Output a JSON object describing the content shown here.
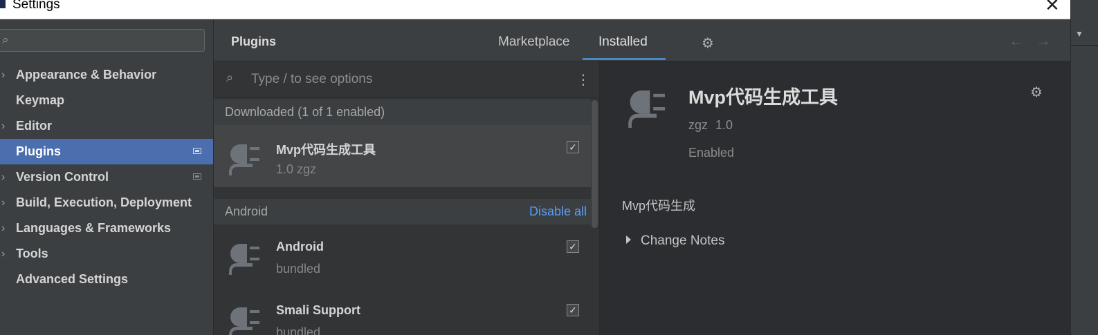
{
  "window": {
    "title": "Settings",
    "close_glyph": "✕"
  },
  "nav": {
    "search_placeholder": "",
    "items": [
      {
        "label": "Appearance & Behavior",
        "expandable": true,
        "selected": false,
        "project_icon": false
      },
      {
        "label": "Keymap",
        "expandable": false,
        "selected": false,
        "project_icon": false
      },
      {
        "label": "Editor",
        "expandable": true,
        "selected": false,
        "project_icon": false
      },
      {
        "label": "Plugins",
        "expandable": false,
        "selected": true,
        "project_icon": true
      },
      {
        "label": "Version Control",
        "expandable": true,
        "selected": false,
        "project_icon": true
      },
      {
        "label": "Build, Execution, Deployment",
        "expandable": true,
        "selected": false,
        "project_icon": false
      },
      {
        "label": "Languages & Frameworks",
        "expandable": true,
        "selected": false,
        "project_icon": false
      },
      {
        "label": "Tools",
        "expandable": true,
        "selected": false,
        "project_icon": false
      },
      {
        "label": "Advanced Settings",
        "expandable": false,
        "selected": false,
        "project_icon": false
      }
    ]
  },
  "header": {
    "title": "Plugins",
    "tabs": [
      {
        "label": "Marketplace",
        "active": false
      },
      {
        "label": "Installed",
        "active": true
      }
    ],
    "back_glyph": "←",
    "forward_glyph": "→"
  },
  "list": {
    "search_placeholder": "Type / to see options",
    "groups": [
      {
        "title": "Downloaded (1 of 1 enabled)",
        "action": "",
        "plugins": [
          {
            "name": "Mvp代码生成工具",
            "meta": "1.0  zgz",
            "enabled": true,
            "selected": true
          }
        ]
      },
      {
        "title": "Android",
        "action": "Disable all",
        "plugins": [
          {
            "name": "Android",
            "meta": "bundled",
            "enabled": true,
            "selected": false
          },
          {
            "name": "Smali Support",
            "meta": "bundled",
            "enabled": true,
            "selected": false
          }
        ]
      }
    ]
  },
  "detail": {
    "name": "Mvp代码生成工具",
    "vendor": "zgz",
    "version": "1.0",
    "status": "Enabled",
    "description": "Mvp代码生成",
    "change_notes_label": "Change Notes"
  },
  "colors": {
    "accent": "#4b6eaf",
    "link": "#589df6",
    "tab_underline": "#4a88c7"
  }
}
